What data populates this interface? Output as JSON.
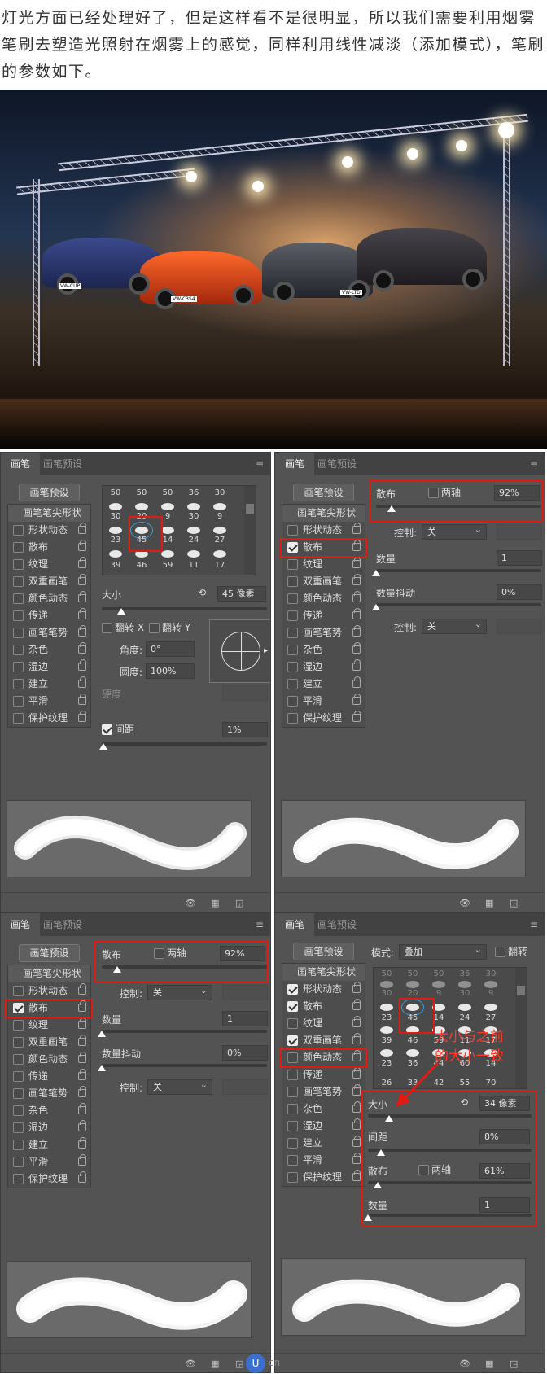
{
  "intro_text": "灯光方面已经处理好了，但是这样看不是很明显，所以我们需要利用烟雾笔刷去塑造光照射在烟雾上的感觉，同样利用线性减淡（添加模式），笔刷的参数如下。",
  "photo": {
    "plates": [
      "VW-CUP",
      "VW-C3S4",
      "VW-LTD",
      ""
    ]
  },
  "common": {
    "tab_brush": "画笔",
    "tab_presets": "画笔预设",
    "preset_button": "画笔预设",
    "menu": "≡",
    "tip_shape": "画笔笔尖形状",
    "items": [
      "形状动态",
      "散布",
      "纹理",
      "双重画笔",
      "颜色动态",
      "传递",
      "画笔笔势",
      "杂色",
      "湿边",
      "建立",
      "平滑",
      "保护纹理"
    ]
  },
  "panel1": {
    "grid_row1": [
      "50",
      "50",
      "50",
      "36",
      "30"
    ],
    "grid_row2": [
      "30",
      "20",
      "9",
      "30",
      "9"
    ],
    "grid_row3": [
      "23",
      "45",
      "14",
      "24",
      "27"
    ],
    "grid_row4": [
      "39",
      "46",
      "59",
      "11",
      "17"
    ],
    "size_label": "大小",
    "size_value": "45 像素",
    "flip_x": "翻转 X",
    "flip_y": "翻转 Y",
    "angle_label": "角度:",
    "angle_value": "0°",
    "roundness_label": "圆度:",
    "roundness_value": "100%",
    "hardness_label": "硬度",
    "spacing_label": "间距",
    "spacing_value": "1%",
    "levels": {
      "size": 0.12,
      "spacing": 0.01
    }
  },
  "panel2": {
    "scatter_label": "散布",
    "both_axes": "两轴",
    "scatter_value": "92%",
    "control_label": "控制:",
    "control_value": "关",
    "count_label": "数量",
    "count_value": "1",
    "count_jitter_label": "数量抖动",
    "count_jitter_value": "0%",
    "control2_value": "关",
    "levels": {
      "scatter": 0.092,
      "count": 0.0,
      "count_jitter": 0.0
    }
  },
  "panel3": {
    "scatter_label": "散布",
    "both_axes": "两轴",
    "scatter_value": "92%",
    "control_label": "控制:",
    "control_value": "关",
    "count_label": "数量",
    "count_value": "1",
    "count_jitter_label": "数量抖动",
    "count_jitter_value": "0%",
    "control2_value": "关",
    "levels": {
      "scatter": 0.092,
      "count": 0.0,
      "count_jitter": 0.0
    }
  },
  "panel4": {
    "mode_label": "模式:",
    "mode_value": "叠加",
    "flip_label": "翻转",
    "grid_row1": [
      "50",
      "50",
      "50",
      "36",
      "30"
    ],
    "grid_row2": [
      "30",
      "20",
      "9",
      "30",
      "9"
    ],
    "grid_row3": [
      "23",
      "45",
      "14",
      "24",
      "27"
    ],
    "grid_row4": [
      "39",
      "46",
      "59",
      "11",
      "17"
    ],
    "grid_row5": [
      "23",
      "36",
      "44",
      "60",
      "14"
    ],
    "grid_row6": [
      "26",
      "33",
      "42",
      "55",
      "70"
    ],
    "size_label": "大小",
    "size_value": "34 像素",
    "spacing_label": "间距",
    "spacing_value": "8%",
    "scatter_label": "散布",
    "both_axes": "两轴",
    "scatter_value": "61%",
    "count_label": "数量",
    "count_value": "1",
    "levels": {
      "size": 0.13,
      "spacing": 0.08,
      "scatter": 0.061,
      "count": 0.0
    },
    "annotation": "大小与之前\n的大小一致"
  },
  "watermark": "cn",
  "accent_color": "#e01b12"
}
